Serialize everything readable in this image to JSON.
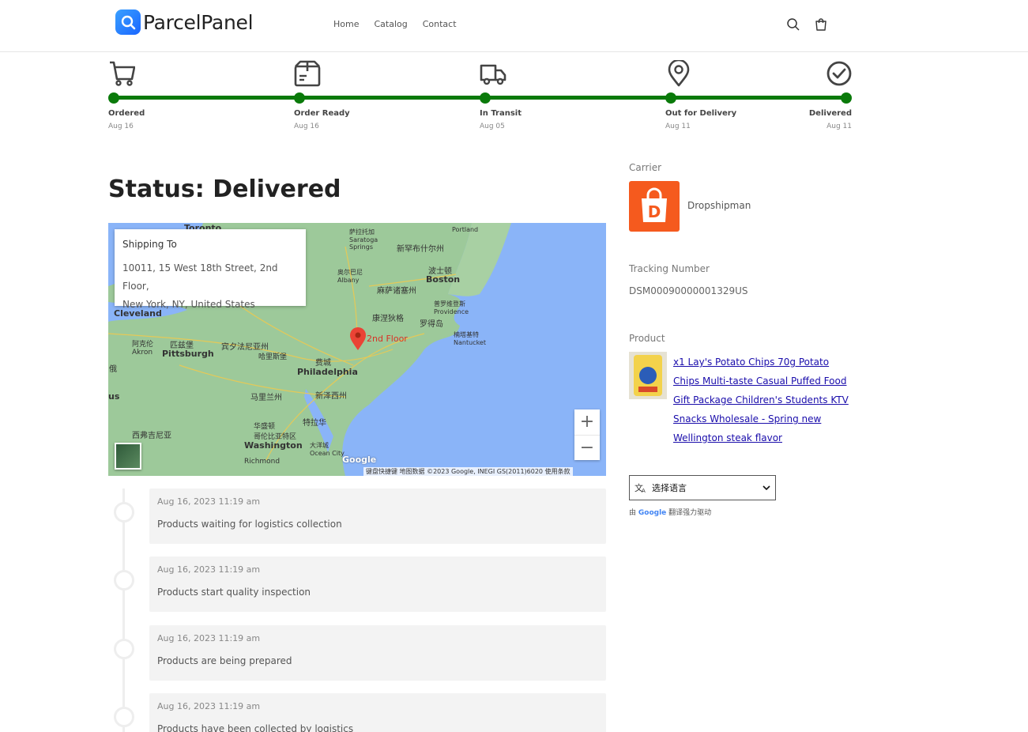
{
  "header": {
    "brand": "ParcelPanel",
    "nav": [
      "Home",
      "Catalog",
      "Contact"
    ],
    "search_icon": "search-icon",
    "cart_icon": "cart-icon"
  },
  "progress": {
    "steps": [
      {
        "label": "Ordered",
        "date": "Aug 16",
        "icon": "cart-icon"
      },
      {
        "label": "Order Ready",
        "date": "Aug 16",
        "icon": "package-icon"
      },
      {
        "label": "In Transit",
        "date": "Aug 05",
        "icon": "truck-icon"
      },
      {
        "label": "Out for Delivery",
        "date": "Aug 11",
        "icon": "pin-icon"
      },
      {
        "label": "Delivered",
        "date": "Aug 11",
        "icon": "check-circle-icon"
      }
    ],
    "accent": "#0a7a0a"
  },
  "status": {
    "title": "Status: Delivered"
  },
  "map": {
    "shipping_title": "Shipping To",
    "address_line1": "10011, 15 West 18th Street, 2nd Floor,",
    "address_line2": "New York, NY, United States",
    "marker_label": "2nd Floor",
    "zoom_in": "+",
    "zoom_out": "−",
    "footer": "键盘快捷键   地图数据 ©2023 Google, INEGI GS(2011)6020   使用条款",
    "google_mark": "Google",
    "labels": {
      "toronto": "Toronto",
      "cleveland": "Cleveland",
      "akron": "阿克伦\nAkron",
      "pittsburgh_cn": "匹兹堡",
      "pittsburgh": "Pittsburgh",
      "pennsylvania": "宾夕法尼亚州",
      "harrisburg": "哈里斯堡",
      "philadelphia_cn": "费城",
      "philadelphia": "Philadelphia",
      "newjersey": "新泽西州",
      "maryland": "马里兰州",
      "delaware": "特拉华",
      "washington_cn": "华盛顿\n哥伦比亚特区",
      "washington": "Washington",
      "richmond": "Richmond",
      "westvirginia": "西弗吉尼亚",
      "oceancity": "大洋城\nOcean City",
      "albany": "奥尔巴尼\nAlbany",
      "saratoga": "萨拉托加\nSaratoga\nSprings",
      "newhampshire": "新罕布什尔州",
      "boston_cn": "波士顿",
      "boston": "Boston",
      "massachusetts": "麻萨诸塞州",
      "connecticut": "康涅狄格",
      "providence": "普罗维登斯\nProvidence",
      "rhodeisland": "罗得岛",
      "nantucket": "楠塔基特\nNantucket",
      "portland": "Portland",
      "ohio": "俄",
      "us": "us"
    }
  },
  "timeline": [
    {
      "time": "Aug 16, 2023 11:19 am",
      "desc": "Products waiting for logistics collection"
    },
    {
      "time": "Aug 16, 2023 11:19 am",
      "desc": "Products start quality inspection"
    },
    {
      "time": "Aug 16, 2023 11:19 am",
      "desc": "Products are being prepared"
    },
    {
      "time": "Aug 16, 2023 11:19 am",
      "desc": "Products have been collected by logistics"
    }
  ],
  "sidebar": {
    "carrier_label": "Carrier",
    "carrier_name": "Dropshipman",
    "carrier_logo_letter": "D",
    "tracking_label": "Tracking Number",
    "tracking_number": "DSM00090000001329US",
    "product_label": "Product",
    "product_name": "x1 Lay's Potato Chips 70g Potato Chips Multi-taste Casual Puffed Food Gift Package Children's Students KTV Snacks Wholesale - Spring new Wellington steak flavor",
    "language_select": "选择语言",
    "powered_prefix": "由",
    "powered_google": "Google",
    "powered_suffix": "翻译强力驱动"
  }
}
